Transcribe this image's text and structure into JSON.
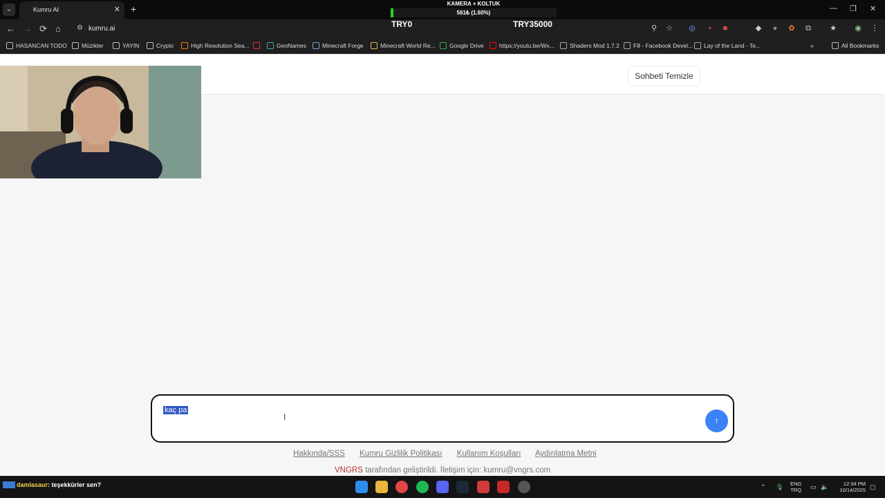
{
  "browser": {
    "tab_title": "Kumru AI",
    "tab_close": "✕",
    "new_tab": "+",
    "url": "kumru.ai",
    "window_controls": [
      "—",
      "❐",
      "✕"
    ]
  },
  "overlay": {
    "title": "KAMERA + KOLTUK",
    "progress_text": "561₺ (1.60%)",
    "progress_fraction": 0.016,
    "min_label": "TRY0",
    "max_label": "TRY35000",
    "fill_color": "#2ed12e"
  },
  "bookmarks": [
    {
      "label": "HASANCAN TODO",
      "icon": "folder-icon"
    },
    {
      "label": "Müzikler",
      "icon": "folder-icon"
    },
    {
      "label": "YAYIN",
      "icon": "folder-icon"
    },
    {
      "label": "Crypto",
      "icon": "folder-icon"
    },
    {
      "label": "High Resolution Sea...",
      "icon": "blogger-icon"
    },
    {
      "label": "",
      "icon": "x-icon"
    },
    {
      "label": "GeoNames",
      "icon": "geonames-icon"
    },
    {
      "label": "Minecraft Forge",
      "icon": "forge-icon"
    },
    {
      "label": "Minecraft World Re...",
      "icon": "torch-icon"
    },
    {
      "label": "Google Drive",
      "icon": "drive-icon"
    },
    {
      "label": "https://youtu.be/Wx...",
      "icon": "youtube-icon"
    },
    {
      "label": "Shaders Mod 1.7.2",
      "icon": "globe-icon"
    },
    {
      "label": "F8 - Facebook Devel...",
      "icon": "globe-icon"
    },
    {
      "label": "Lay of the Land - Te...",
      "icon": "globe-icon"
    },
    {
      "label": "All Bookmarks",
      "icon": "folder-icon"
    }
  ],
  "page": {
    "title_fragment": "bet",
    "clear_button": "Sohbeti Temizle",
    "input_value": "kaç pa",
    "send_icon": "↑",
    "footer_links": [
      "Hakkında/SSS",
      "Kumru Gizlilik Politikası",
      "Kullanım Koşulları",
      "Aydınlatma Metni"
    ],
    "credit_brand": "VNGRS",
    "credit_text": " tarafından geliştirildi. İletişim için: kumru@vngrs.com",
    "accent_color": "#3b82f6"
  },
  "taskbar": {
    "chat_user": "damlasaur",
    "chat_message": ": teşekkürler sen?",
    "lang_top": "ENG",
    "lang_bottom": "TRQ",
    "time": "12:34 PM",
    "date": "10/14/2025"
  }
}
